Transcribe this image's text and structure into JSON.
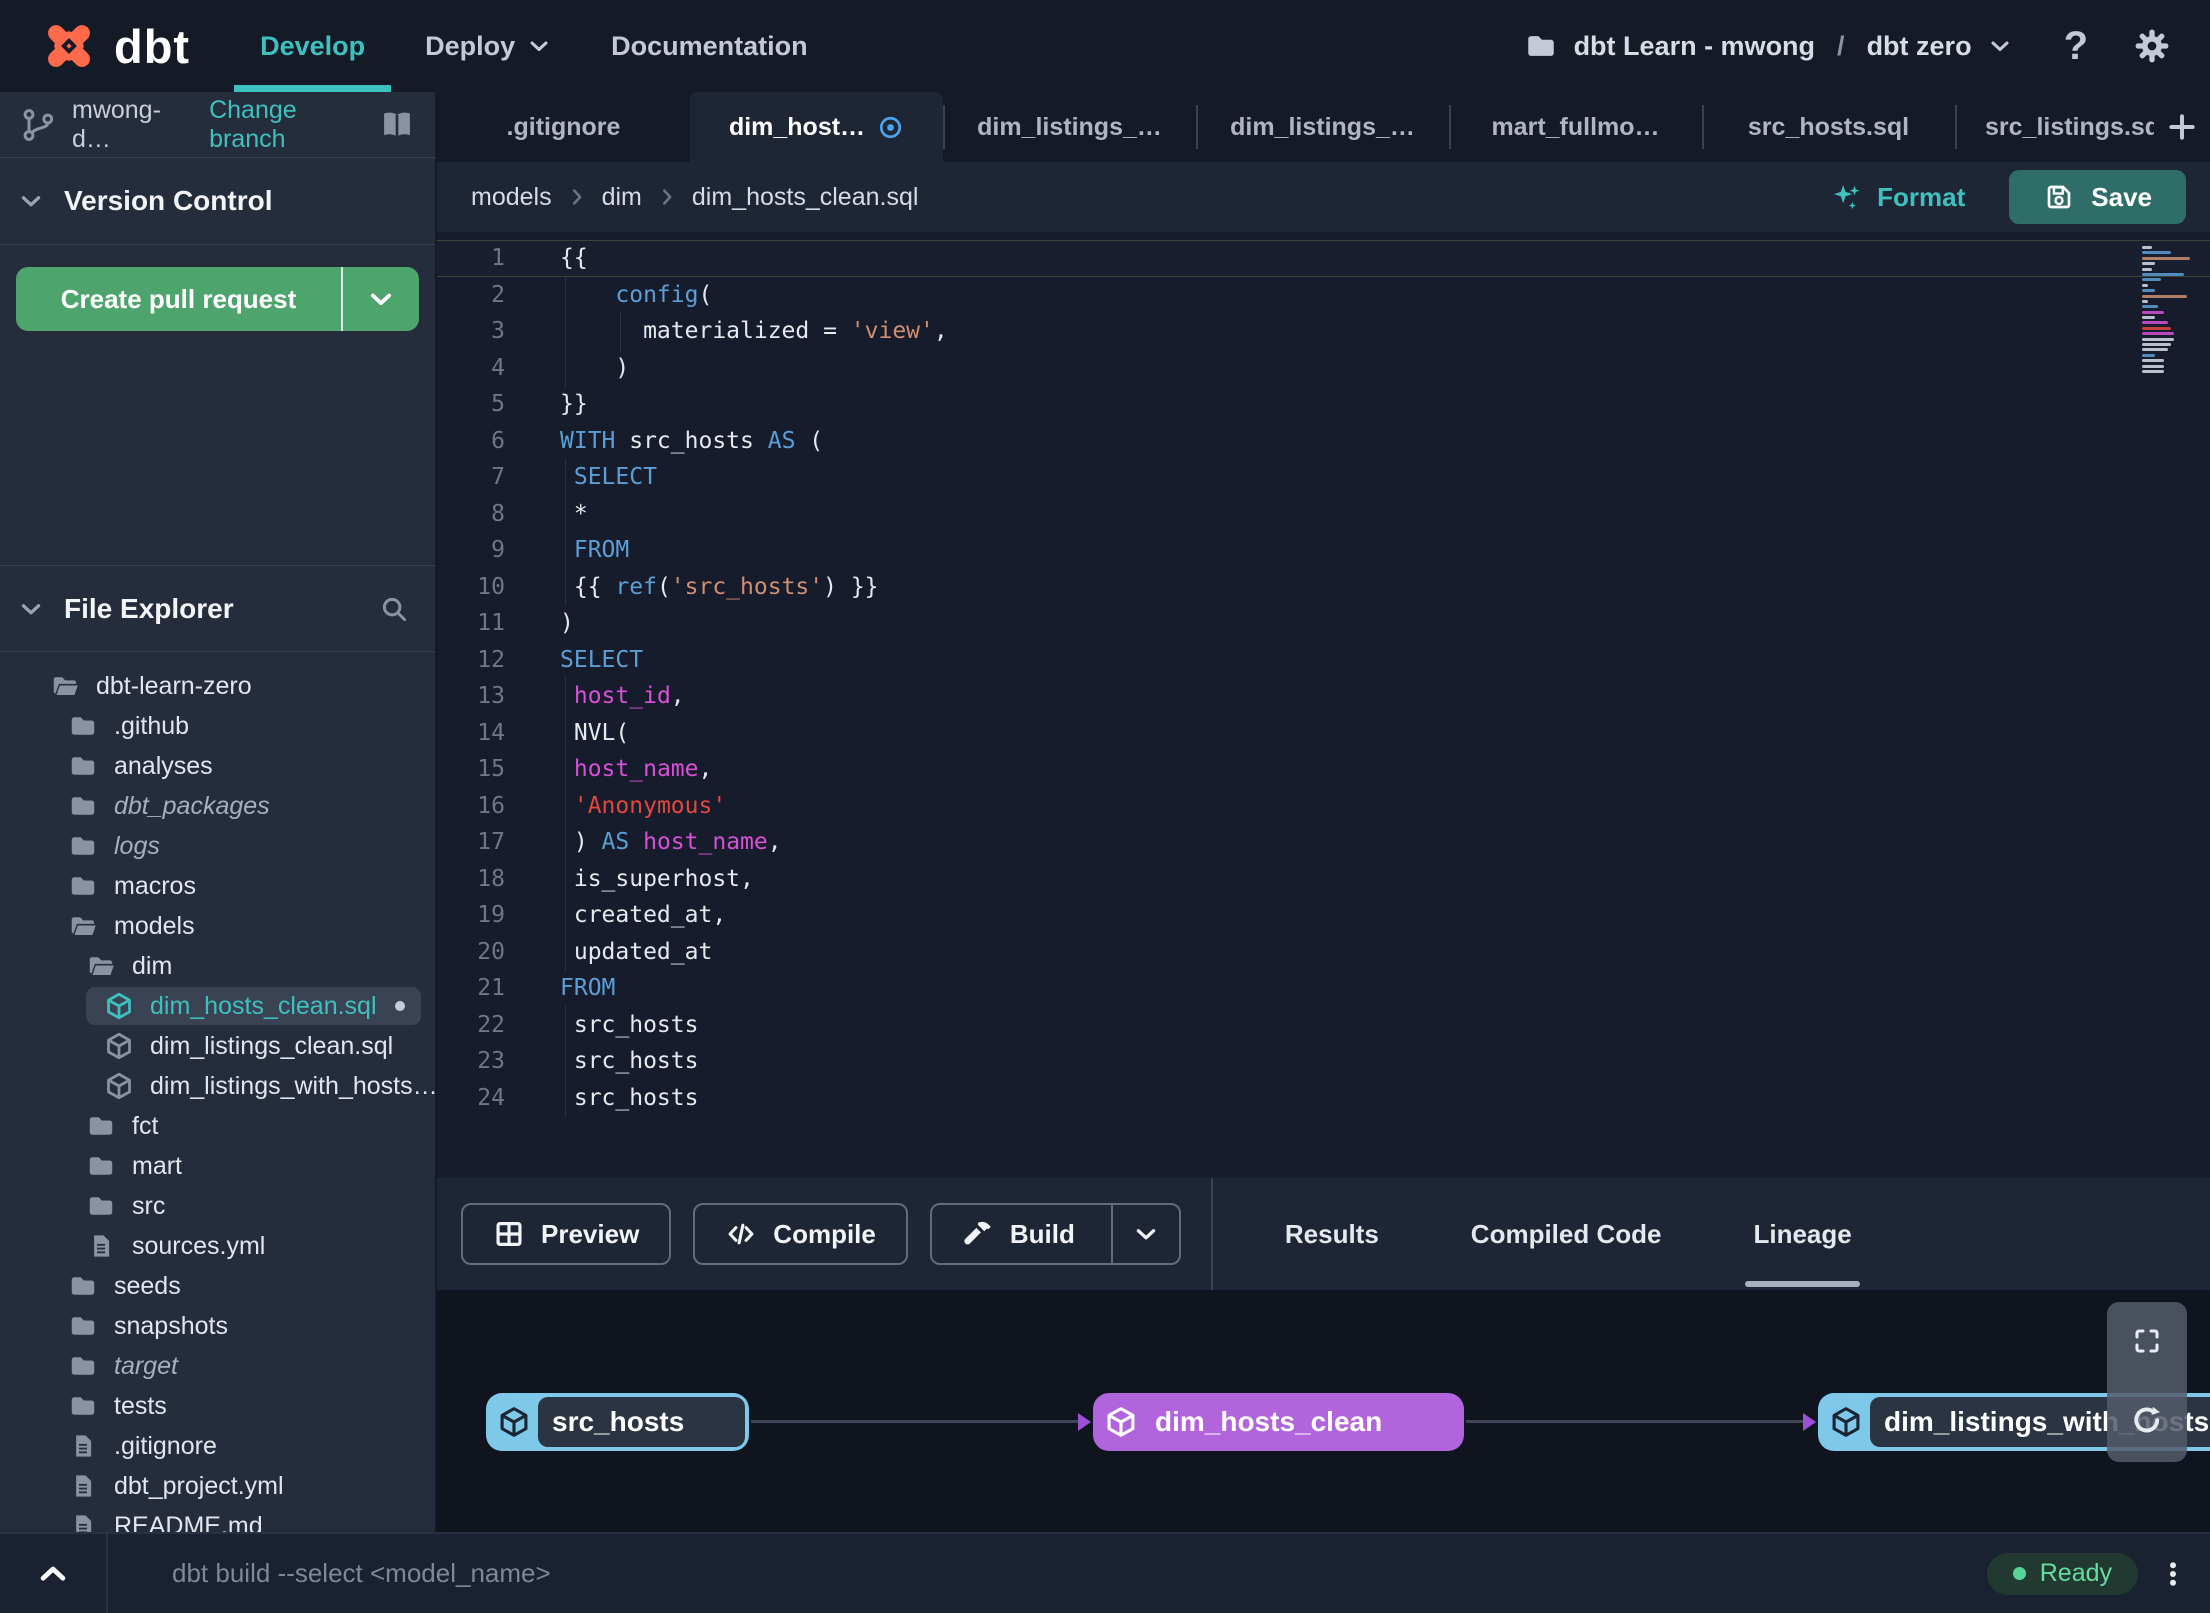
{
  "navbar": {
    "logo": "dbt",
    "nav": [
      {
        "label": "Develop",
        "active": true
      },
      {
        "label": "Deploy",
        "chevron": true
      },
      {
        "label": "Documentation"
      }
    ],
    "project": {
      "account": "dbt Learn - mwong",
      "sep": "/",
      "name": "dbt zero"
    }
  },
  "sidebar": {
    "branch": {
      "name": "mwong-d…",
      "change": "Change branch"
    },
    "version_control_title": "Version Control",
    "create_pr": "Create pull request",
    "file_explorer_title": "File Explorer",
    "tree": [
      {
        "name": "dbt-learn-zero",
        "icon": "folder-open",
        "depth": 0
      },
      {
        "name": ".github",
        "icon": "folder",
        "depth": 1
      },
      {
        "name": "analyses",
        "icon": "folder",
        "depth": 1
      },
      {
        "name": "dbt_packages",
        "icon": "folder",
        "depth": 1,
        "italic": true
      },
      {
        "name": "logs",
        "icon": "folder",
        "depth": 1,
        "italic": true
      },
      {
        "name": "macros",
        "icon": "folder",
        "depth": 1
      },
      {
        "name": "models",
        "icon": "folder-open",
        "depth": 1
      },
      {
        "name": "dim",
        "icon": "folder-open",
        "depth": 2
      },
      {
        "name": "dim_hosts_clean.sql",
        "icon": "cube",
        "depth": 3,
        "selected": true,
        "modified": true
      },
      {
        "name": "dim_listings_clean.sql",
        "icon": "cube",
        "depth": 3
      },
      {
        "name": "dim_listings_with_hosts…",
        "icon": "cube",
        "depth": 3
      },
      {
        "name": "fct",
        "icon": "folder",
        "depth": 2
      },
      {
        "name": "mart",
        "icon": "folder",
        "depth": 2
      },
      {
        "name": "src",
        "icon": "folder",
        "depth": 2
      },
      {
        "name": "sources.yml",
        "icon": "file",
        "depth": 2
      },
      {
        "name": "seeds",
        "icon": "folder",
        "depth": 1
      },
      {
        "name": "snapshots",
        "icon": "folder",
        "depth": 1
      },
      {
        "name": "target",
        "icon": "folder",
        "depth": 1,
        "italic": true
      },
      {
        "name": "tests",
        "icon": "folder",
        "depth": 1
      },
      {
        "name": ".gitignore",
        "icon": "file",
        "depth": 1
      },
      {
        "name": "dbt_project.yml",
        "icon": "file",
        "depth": 1
      },
      {
        "name": "README.md",
        "icon": "file",
        "depth": 1
      }
    ]
  },
  "tabs": {
    "items": [
      {
        "label": ".gitignore"
      },
      {
        "label": "dim_host…",
        "active": true,
        "icon": "target"
      },
      {
        "label": "dim_listings_…"
      },
      {
        "label": "dim_listings_…"
      },
      {
        "label": "mart_fullmo…"
      },
      {
        "label": "src_hosts.sql"
      },
      {
        "label": "src_listings.sql",
        "clipped": true
      }
    ]
  },
  "editor": {
    "breadcrumb": [
      "models",
      "dim",
      "dim_hosts_clean.sql"
    ],
    "format": "Format",
    "save": "Save",
    "code": [
      {
        "n": 1,
        "active": true,
        "seg": [
          [
            "{{",
            "d"
          ]
        ]
      },
      {
        "n": 2,
        "g": [
          0
        ],
        "seg": [
          [
            "    ",
            "d"
          ],
          [
            "config",
            "k"
          ],
          [
            "(",
            "d"
          ]
        ]
      },
      {
        "n": 3,
        "g": [
          0,
          4
        ],
        "seg": [
          [
            "      materialized = ",
            "d"
          ],
          [
            "'view'",
            "s"
          ],
          [
            ",",
            "d"
          ]
        ]
      },
      {
        "n": 4,
        "g": [
          0
        ],
        "seg": [
          [
            "    )",
            "d"
          ]
        ]
      },
      {
        "n": 5,
        "seg": [
          [
            "}}",
            "d"
          ]
        ]
      },
      {
        "n": 6,
        "seg": [
          [
            "WITH",
            "k"
          ],
          [
            " src_hosts ",
            "d"
          ],
          [
            "AS",
            "k"
          ],
          [
            " (",
            "d"
          ]
        ]
      },
      {
        "n": 7,
        "g": [
          0
        ],
        "seg": [
          [
            " ",
            "d"
          ],
          [
            "SELECT",
            "k"
          ]
        ]
      },
      {
        "n": 8,
        "g": [
          0
        ],
        "seg": [
          [
            " *",
            "d"
          ]
        ]
      },
      {
        "n": 9,
        "g": [
          0
        ],
        "seg": [
          [
            " ",
            "d"
          ],
          [
            "FROM",
            "k"
          ]
        ]
      },
      {
        "n": 10,
        "g": [
          0
        ],
        "seg": [
          [
            " {{ ",
            "d"
          ],
          [
            "ref",
            "k"
          ],
          [
            "(",
            "d"
          ],
          [
            "'src_hosts'",
            "s"
          ],
          [
            ") }}",
            "d"
          ]
        ]
      },
      {
        "n": 11,
        "seg": [
          [
            ")",
            "d"
          ]
        ]
      },
      {
        "n": 12,
        "seg": [
          [
            "SELECT",
            "k"
          ]
        ]
      },
      {
        "n": 13,
        "g": [
          0
        ],
        "seg": [
          [
            " ",
            "d"
          ],
          [
            "host_id",
            "m"
          ],
          [
            ",",
            "d"
          ]
        ]
      },
      {
        "n": 14,
        "g": [
          0
        ],
        "seg": [
          [
            " NVL(",
            "d"
          ]
        ]
      },
      {
        "n": 15,
        "g": [
          0
        ],
        "seg": [
          [
            " ",
            "d"
          ],
          [
            "host_name",
            "m"
          ],
          [
            ",",
            "d"
          ]
        ]
      },
      {
        "n": 16,
        "g": [
          0
        ],
        "seg": [
          [
            " ",
            "d"
          ],
          [
            "'Anonymous'",
            "r"
          ]
        ]
      },
      {
        "n": 17,
        "g": [
          0
        ],
        "seg": [
          [
            " ) ",
            "d"
          ],
          [
            "AS",
            "k"
          ],
          [
            " ",
            "d"
          ],
          [
            "host_name",
            "m"
          ],
          [
            ",",
            "d"
          ]
        ]
      },
      {
        "n": 18,
        "g": [
          0
        ],
        "seg": [
          [
            " is_superhost,",
            "d"
          ]
        ]
      },
      {
        "n": 19,
        "g": [
          0
        ],
        "seg": [
          [
            " created_at,",
            "d"
          ]
        ]
      },
      {
        "n": 20,
        "g": [
          0
        ],
        "seg": [
          [
            " updated_at",
            "d"
          ]
        ]
      },
      {
        "n": 21,
        "seg": [
          [
            "FROM",
            "k"
          ]
        ]
      },
      {
        "n": 22,
        "g": [
          0
        ],
        "seg": [
          [
            " src_hosts",
            "d"
          ]
        ]
      },
      {
        "n": 23,
        "g": [
          0
        ],
        "seg": [
          [
            " src_hosts",
            "d"
          ]
        ]
      },
      {
        "n": 24,
        "g": [
          0
        ],
        "seg": [
          [
            " src_hosts",
            "d"
          ]
        ]
      }
    ],
    "minimap": [
      [
        6,
        "w"
      ],
      [
        18,
        "b"
      ],
      [
        30,
        "s"
      ],
      [
        8,
        "w"
      ],
      [
        6,
        "w"
      ],
      [
        26,
        "b"
      ],
      [
        12,
        "b"
      ],
      [
        4,
        "w"
      ],
      [
        8,
        "b"
      ],
      [
        28,
        "s"
      ],
      [
        4,
        "w"
      ],
      [
        10,
        "b"
      ],
      [
        14,
        "m"
      ],
      [
        8,
        "w"
      ],
      [
        16,
        "m"
      ],
      [
        18,
        "r"
      ],
      [
        20,
        "m"
      ],
      [
        20,
        "w"
      ],
      [
        18,
        "w"
      ],
      [
        16,
        "w"
      ],
      [
        8,
        "b"
      ],
      [
        14,
        "w"
      ],
      [
        14,
        "w"
      ],
      [
        14,
        "w"
      ]
    ]
  },
  "panel": {
    "actions": [
      {
        "label": "Preview",
        "icon": "grid"
      },
      {
        "label": "Compile",
        "icon": "code"
      },
      {
        "label": "Build",
        "icon": "hammer",
        "split": true
      }
    ],
    "tabs": [
      {
        "label": "Results"
      },
      {
        "label": "Compiled Code"
      },
      {
        "label": "Lineage",
        "active": true
      }
    ]
  },
  "lineage": {
    "nodes": [
      {
        "label": "src_hosts",
        "style": "source"
      },
      {
        "label": "dim_hosts_clean",
        "style": "model"
      },
      {
        "label": "dim_listings_with_hosts",
        "style": "source"
      }
    ]
  },
  "command_bar": {
    "command": "dbt build --select <model_name>",
    "status": "Ready"
  },
  "colors": {
    "accent_teal": "#3EC1BE",
    "save_button": "#2F6E68",
    "create_pr_green": "#4EA46D",
    "node_source_blue": "#7EC9EA",
    "node_model_purple": "#B164DB",
    "edge_arrow_purple": "#9C50D6",
    "status_ready_green": "#57D598",
    "code_keyword": "#5C9FD6",
    "code_string": "#CE8F72",
    "code_string_red": "#E3483E",
    "code_identifier": "#D651D6",
    "logo_orange": "#FF6B4A"
  }
}
